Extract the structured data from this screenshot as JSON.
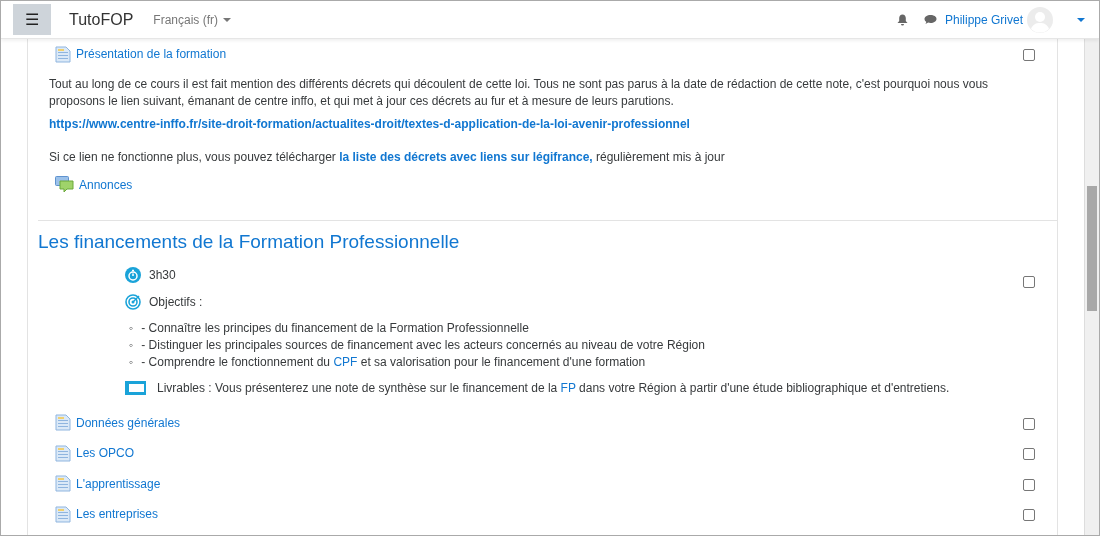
{
  "navbar": {
    "menu_icon": "☰",
    "brand": "TutoFOP",
    "language": "Français (fr)",
    "user_name": "Philippe Grivet"
  },
  "section_1": {
    "activities": [
      {
        "kind": "page",
        "title": "Présentation de la formation",
        "checked": false,
        "description": [
          [
            {
              "t": "Tout au long de ce cours il est fait mention des différents décrets qui découlent de cette loi. Tous ne sont pas parus à la date de rédaction de cette note, c'est pourquoi nous vous proposons le lien suivant, émanant de centre inffo, et qui met à jour ces décrets au fur et à mesure de leurs parutions."
            }
          ],
          [
            {
              "link": "https://www.centre-inffo.fr/site-droit-formation/actualites-droit/textes-d-application-de-la-loi-avenir-professionnel"
            }
          ],
          [
            {
              "t": "Si ce lien ne fonctionne plus, vous pouvez télécharger "
            },
            {
              "link": "la liste des décrets avec liens sur légifrance,"
            },
            {
              "t": " régulièrement mis à jour"
            }
          ]
        ]
      },
      {
        "kind": "forum",
        "title": "Annonces"
      }
    ]
  },
  "section_2": {
    "title": "Les financements de la Formation Professionnelle",
    "label": {
      "checked": false,
      "duration": "3h30",
      "objectives_heading": "Objectifs :",
      "objectives": [
        {
          "marker": "◦",
          "text": [
            {
              "t": "- Connaître les principes du financement de la Formation Professionnelle"
            }
          ]
        },
        {
          "marker": "◦",
          "text": [
            {
              "t": "- Distinguer les principales sources de financement avec les acteurs concernés au niveau de votre Région"
            }
          ]
        },
        {
          "marker": "◦",
          "text": [
            {
              "t": "- Comprendre le fonctionnement du "
            },
            {
              "link": "CPF"
            },
            {
              "t": " et sa valorisation pour le financement d'une formation"
            }
          ]
        }
      ],
      "deliverables": [
        {
          "t": "Livrables : Vous présenterez une note de synthèse sur le financement de la "
        },
        {
          "link": "FP"
        },
        {
          "t": " dans votre Région à partir d'une étude bibliographique et d'entretiens."
        }
      ]
    },
    "activities": [
      {
        "kind": "page",
        "title": "Données générales",
        "checked": false
      },
      {
        "kind": "page",
        "title": "Les OPCO",
        "checked": false
      },
      {
        "kind": "page",
        "title": "L'apprentissage",
        "checked": false
      },
      {
        "kind": "page",
        "title": "Les entreprises",
        "checked": false
      }
    ]
  }
}
